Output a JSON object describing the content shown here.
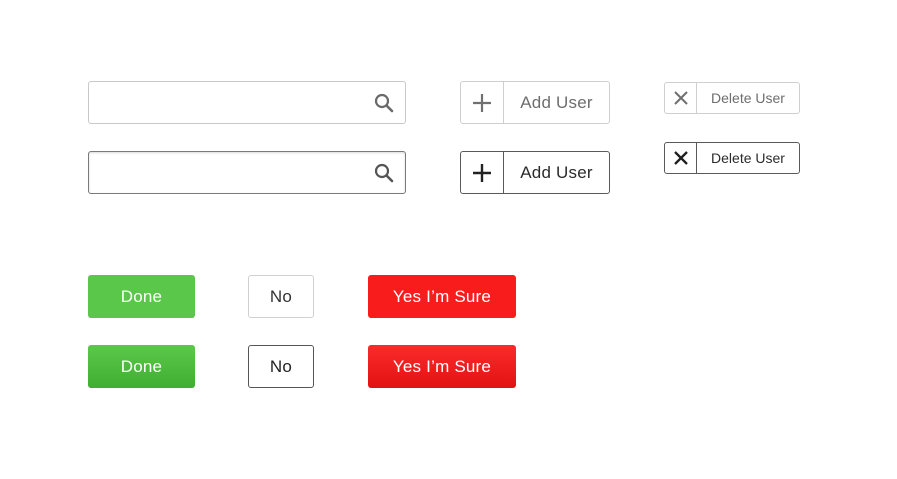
{
  "search": {
    "light": {
      "value": "",
      "placeholder": "",
      "icon": "search-icon"
    },
    "dark": {
      "value": "",
      "placeholder": "",
      "icon": "search-icon"
    }
  },
  "add_user": {
    "light_label": "Add User",
    "dark_label": "Add User",
    "icon": "plus-icon"
  },
  "delete_user": {
    "light_label": "Delete User",
    "dark_label": "Delete User",
    "icon": "close-icon"
  },
  "actions": {
    "done_label": "Done",
    "no_label": "No",
    "sure_label": "Yes I’m Sure"
  },
  "colors": {
    "done_green": "#5ac64a",
    "sure_red": "#f81c1c",
    "light_border": "#cfcfcf",
    "dark_border": "#5a5a5a"
  }
}
